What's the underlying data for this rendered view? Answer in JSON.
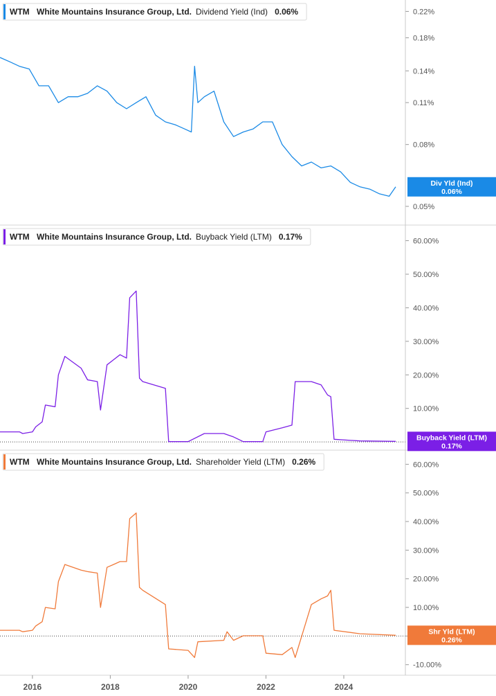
{
  "chart_data": [
    {
      "type": "line",
      "ticker": "WTM",
      "company": "White Mountains Insurance Group, Ltd.",
      "metric": "Dividend Yield (Ind)",
      "current": "0.06%",
      "badge_label": "Div Yld (Ind)",
      "badge_value": "0.06%",
      "color": "#1a8ae6",
      "scale": "log",
      "ylim": [
        0.045,
        0.23
      ],
      "y_ticks": [
        {
          "v": 0.22,
          "label": "0.22%"
        },
        {
          "v": 0.18,
          "label": "0.18%"
        },
        {
          "v": 0.14,
          "label": "0.14%"
        },
        {
          "v": 0.11,
          "label": "0.11%"
        },
        {
          "v": 0.08,
          "label": "0.08%"
        },
        {
          "v": 0.05,
          "label": "0.05%"
        }
      ],
      "zero_line": false,
      "series": [
        {
          "x": [
            "2015-03",
            "2015-06",
            "2015-09",
            "2015-12",
            "2016-03",
            "2016-06",
            "2016-09",
            "2016-12",
            "2017-03",
            "2017-06",
            "2017-09",
            "2017-12",
            "2018-03",
            "2018-06",
            "2018-09",
            "2018-12",
            "2019-03",
            "2019-06",
            "2019-09",
            "2019-12",
            "2020-02",
            "2020-03",
            "2020-04",
            "2020-06",
            "2020-09",
            "2020-12",
            "2021-03",
            "2021-06",
            "2021-09",
            "2021-12",
            "2022-03",
            "2022-06",
            "2022-09",
            "2022-12",
            "2023-03",
            "2023-06",
            "2023-09",
            "2023-12",
            "2024-03",
            "2024-06",
            "2024-09",
            "2024-12",
            "2025-03",
            "2025-05"
          ],
          "values": [
            0.155,
            0.15,
            0.145,
            0.142,
            0.125,
            0.125,
            0.11,
            0.115,
            0.115,
            0.118,
            0.125,
            0.12,
            0.11,
            0.105,
            0.11,
            0.115,
            0.1,
            0.095,
            0.093,
            0.09,
            0.088,
            0.145,
            0.11,
            0.115,
            0.12,
            0.095,
            0.085,
            0.088,
            0.09,
            0.095,
            0.095,
            0.08,
            0.073,
            0.068,
            0.07,
            0.067,
            0.068,
            0.065,
            0.06,
            0.058,
            0.057,
            0.055,
            0.054,
            0.058
          ]
        }
      ]
    },
    {
      "type": "line",
      "ticker": "WTM",
      "company": "White Mountains Insurance Group, Ltd.",
      "metric": "Buyback Yield (LTM)",
      "current": "0.17%",
      "badge_label": "Buyback Yield (LTM)",
      "badge_value": "0.17%",
      "color": "#7b1fe6",
      "scale": "linear",
      "ylim": [
        -1,
        63
      ],
      "y_ticks": [
        {
          "v": 60,
          "label": "60.00%"
        },
        {
          "v": 50,
          "label": "50.00%"
        },
        {
          "v": 40,
          "label": "40.00%"
        },
        {
          "v": 30,
          "label": "30.00%"
        },
        {
          "v": 20,
          "label": "20.00%"
        },
        {
          "v": 10,
          "label": "10.00%"
        }
      ],
      "zero_line": true,
      "series": [
        {
          "x": [
            "2015-03",
            "2015-09",
            "2015-10",
            "2016-01",
            "2016-02",
            "2016-04",
            "2016-05",
            "2016-08",
            "2016-09",
            "2016-11",
            "2017-04",
            "2017-06",
            "2017-09",
            "2017-10",
            "2017-12",
            "2018-02",
            "2018-04",
            "2018-06",
            "2018-07",
            "2018-09",
            "2018-10",
            "2018-11",
            "2019-06",
            "2019-07",
            "2020-01",
            "2020-06",
            "2020-12",
            "2021-03",
            "2021-06",
            "2021-12",
            "2022-01",
            "2022-06",
            "2022-09",
            "2022-10",
            "2023-03",
            "2023-06",
            "2023-08",
            "2023-09",
            "2023-10",
            "2024-06",
            "2025-05"
          ],
          "values": [
            3,
            3,
            2.5,
            3,
            4.5,
            6,
            11,
            10.5,
            20,
            25.5,
            22,
            18.5,
            18,
            9.5,
            23,
            24.5,
            26,
            25,
            43,
            45,
            19,
            18,
            16,
            0.1,
            0.1,
            2.5,
            2.5,
            1.5,
            0.1,
            0.1,
            3,
            4.2,
            5,
            18,
            18,
            17,
            14,
            13.5,
            0.8,
            0.3,
            0.17
          ]
        }
      ]
    },
    {
      "type": "line",
      "ticker": "WTM",
      "company": "White Mountains Insurance Group, Ltd.",
      "metric": "Shareholder Yield (LTM)",
      "current": "0.26%",
      "badge_label": "Shr Yld (LTM)",
      "badge_value": "0.26%",
      "color": "#f07a3a",
      "scale": "linear",
      "ylim": [
        -12,
        63
      ],
      "y_ticks": [
        {
          "v": 60,
          "label": "60.00%"
        },
        {
          "v": 50,
          "label": "50.00%"
        },
        {
          "v": 40,
          "label": "40.00%"
        },
        {
          "v": 30,
          "label": "30.00%"
        },
        {
          "v": 20,
          "label": "20.00%"
        },
        {
          "v": 10,
          "label": "10.00%"
        },
        {
          "v": 0,
          "label": "0.00%"
        },
        {
          "v": -10,
          "label": "-10.00%"
        }
      ],
      "zero_line": true,
      "series": [
        {
          "x": [
            "2015-03",
            "2015-09",
            "2015-10",
            "2016-01",
            "2016-02",
            "2016-04",
            "2016-05",
            "2016-08",
            "2016-09",
            "2016-11",
            "2017-04",
            "2017-06",
            "2017-09",
            "2017-10",
            "2017-12",
            "2018-02",
            "2018-04",
            "2018-06",
            "2018-07",
            "2018-09",
            "2018-10",
            "2018-11",
            "2019-06",
            "2019-07",
            "2020-01",
            "2020-03",
            "2020-04",
            "2020-12",
            "2021-01",
            "2021-03",
            "2021-06",
            "2021-12",
            "2022-01",
            "2022-06",
            "2022-09",
            "2022-10",
            "2023-03",
            "2023-06",
            "2023-08",
            "2023-09",
            "2023-10",
            "2024-06",
            "2025-05"
          ],
          "values": [
            2,
            2,
            1.5,
            2,
            3.5,
            5,
            10,
            9.5,
            19,
            25,
            23,
            22.5,
            22,
            10,
            24,
            25,
            26,
            26,
            41,
            43,
            17,
            16,
            11,
            -4.5,
            -5,
            -7.5,
            -2,
            -1.5,
            1.5,
            -1.5,
            0.1,
            0.1,
            -6,
            -6.5,
            -4,
            -7.5,
            11,
            13,
            14,
            16,
            2,
            0.8,
            0.26
          ]
        }
      ]
    }
  ],
  "x_axis": {
    "start": "2015-03",
    "end": "2025-05",
    "labels": [
      "2016",
      "2018",
      "2020",
      "2022",
      "2024"
    ]
  }
}
